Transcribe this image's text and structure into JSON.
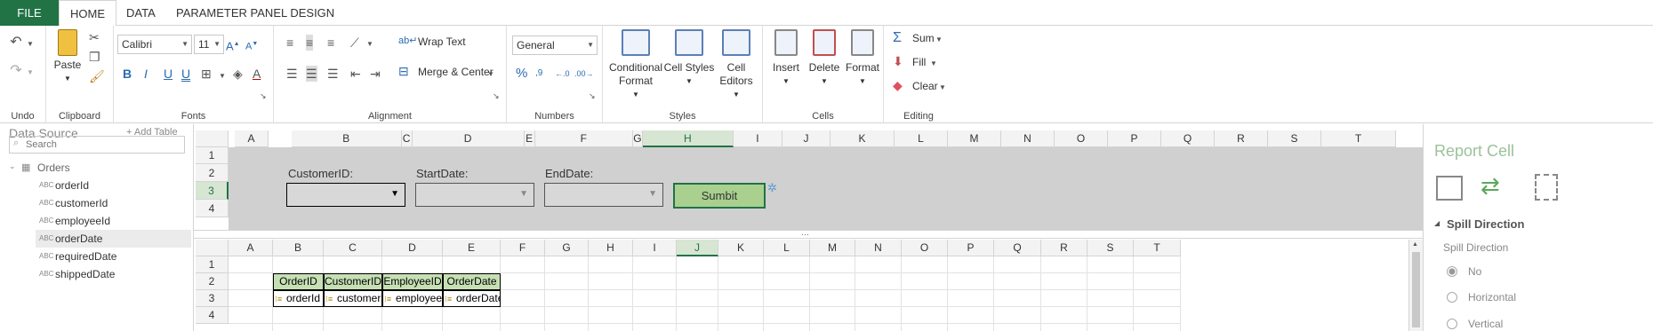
{
  "tabs": {
    "file": "FILE",
    "home": "HOME",
    "data": "DATA",
    "ppd": "PARAMETER PANEL DESIGN"
  },
  "ribbon": {
    "undo_group": "Undo",
    "clipboard": {
      "paste": "Paste",
      "group": "Clipboard"
    },
    "fonts": {
      "family": "Calibri",
      "size": "11",
      "group": "Fonts"
    },
    "alignment": {
      "wrap": "Wrap Text",
      "merge": "Merge & Center",
      "group": "Alignment"
    },
    "numbers": {
      "format": "General",
      "group": "Numbers"
    },
    "styles": {
      "cond1": "Conditional",
      "cond2": "Format",
      "cell_styles": "Cell Styles",
      "editors1": "Cell",
      "editors2": "Editors",
      "group": "Styles"
    },
    "cells": {
      "insert": "Insert",
      "delete": "Delete",
      "format": "Format",
      "group": "Cells"
    },
    "editing": {
      "sum": "Sum",
      "fill": "Fill",
      "clear": "Clear",
      "group": "Editing"
    }
  },
  "datasource": {
    "title": "Data Source",
    "add_table": "+ Add Table",
    "search_placeholder": "Search",
    "table": "Orders",
    "fields": [
      "orderId",
      "customerId",
      "employeeId",
      "orderDate",
      "requiredDate",
      "shippedDate"
    ],
    "type_badge": "ABC"
  },
  "columns": [
    "A",
    "B",
    "C",
    "D",
    "E",
    "F",
    "G",
    "H",
    "I",
    "J",
    "K",
    "L",
    "M",
    "N",
    "O",
    "P",
    "Q",
    "R",
    "S",
    "T"
  ],
  "rows": [
    "1",
    "2",
    "3",
    "4"
  ],
  "param_panel": {
    "customer_label": "CustomerID:",
    "start_label": "StartDate:",
    "end_label": "EndDate:",
    "submit": "Sumbit"
  },
  "report": {
    "headers": [
      "OrderID",
      "CustomerID",
      "EmployeeID",
      "OrderDate"
    ],
    "cells": [
      "orderId",
      "customer",
      "employee",
      "orderDate"
    ]
  },
  "right_panel": {
    "title": "Report Cell",
    "section": "Spill Direction",
    "label": "Spill Direction",
    "options": [
      "No",
      "Horizontal",
      "Vertical"
    ]
  },
  "colors": {
    "accent": "#217346",
    "header_fill": "#c6e0b4",
    "panel_bg": "#d0d0d0",
    "button_fill": "#a9d08e"
  }
}
